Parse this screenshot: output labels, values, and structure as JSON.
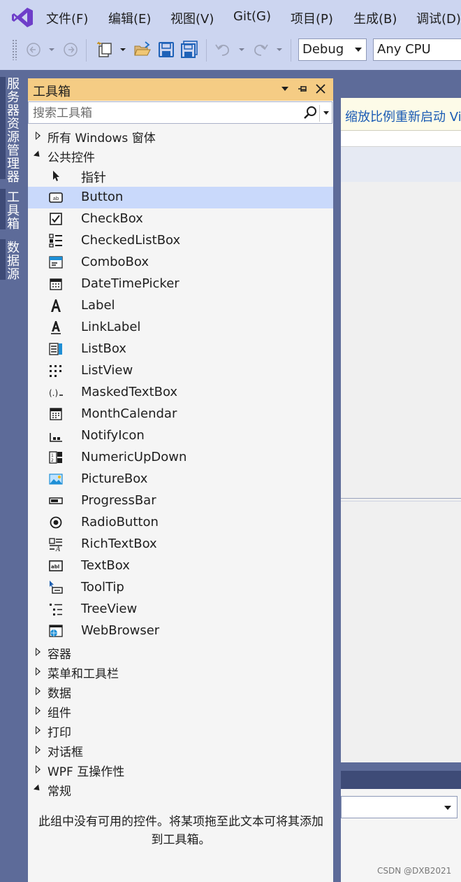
{
  "menu": [
    "文件(F)",
    "编辑(E)",
    "视图(V)",
    "Git(G)",
    "项目(P)",
    "生成(B)",
    "调试(D)"
  ],
  "toolbar": {
    "config": "Debug",
    "platform": "Any CPU"
  },
  "side_tabs": [
    "服务器资源管理器",
    "工具箱",
    "数据源"
  ],
  "toolbox": {
    "title": "工具箱",
    "search_placeholder": "搜索工具箱",
    "groups_top": [
      {
        "label": "所有 Windows 窗体",
        "expanded": false
      },
      {
        "label": "公共控件",
        "expanded": true
      }
    ],
    "items": [
      {
        "label": "指针",
        "icon": "pointer-icon"
      },
      {
        "label": "Button",
        "icon": "button-icon"
      },
      {
        "label": "CheckBox",
        "icon": "checkbox-icon"
      },
      {
        "label": "CheckedListBox",
        "icon": "checkedlistbox-icon"
      },
      {
        "label": "ComboBox",
        "icon": "combobox-icon"
      },
      {
        "label": "DateTimePicker",
        "icon": "datetimepicker-icon"
      },
      {
        "label": "Label",
        "icon": "label-icon"
      },
      {
        "label": "LinkLabel",
        "icon": "linklabel-icon"
      },
      {
        "label": "ListBox",
        "icon": "listbox-icon"
      },
      {
        "label": "ListView",
        "icon": "listview-icon"
      },
      {
        "label": "MaskedTextBox",
        "icon": "maskedtextbox-icon"
      },
      {
        "label": "MonthCalendar",
        "icon": "monthcalendar-icon"
      },
      {
        "label": "NotifyIcon",
        "icon": "notifyicon-icon"
      },
      {
        "label": "NumericUpDown",
        "icon": "numericupdown-icon"
      },
      {
        "label": "PictureBox",
        "icon": "picturebox-icon"
      },
      {
        "label": "ProgressBar",
        "icon": "progressbar-icon"
      },
      {
        "label": "RadioButton",
        "icon": "radiobutton-icon"
      },
      {
        "label": "RichTextBox",
        "icon": "richtextbox-icon"
      },
      {
        "label": "TextBox",
        "icon": "textbox-icon"
      },
      {
        "label": "ToolTip",
        "icon": "tooltip-icon"
      },
      {
        "label": "TreeView",
        "icon": "treeview-icon"
      },
      {
        "label": "WebBrowser",
        "icon": "webbrowser-icon"
      }
    ],
    "selected_item": "Button",
    "groups_bottom": [
      {
        "label": "容器",
        "expanded": false
      },
      {
        "label": "菜单和工具栏",
        "expanded": false
      },
      {
        "label": "数据",
        "expanded": false
      },
      {
        "label": "组件",
        "expanded": false
      },
      {
        "label": "打印",
        "expanded": false
      },
      {
        "label": "对话框",
        "expanded": false
      },
      {
        "label": "WPF 互操作性",
        "expanded": false
      },
      {
        "label": "常规",
        "expanded": true
      }
    ],
    "empty_group_message": "此组中没有可用的控件。将某项拖至此文本可将其添加到工具箱。"
  },
  "infobar_text": "缩放比例重新启动 Vi",
  "watermark": "CSDN @DXB2021"
}
